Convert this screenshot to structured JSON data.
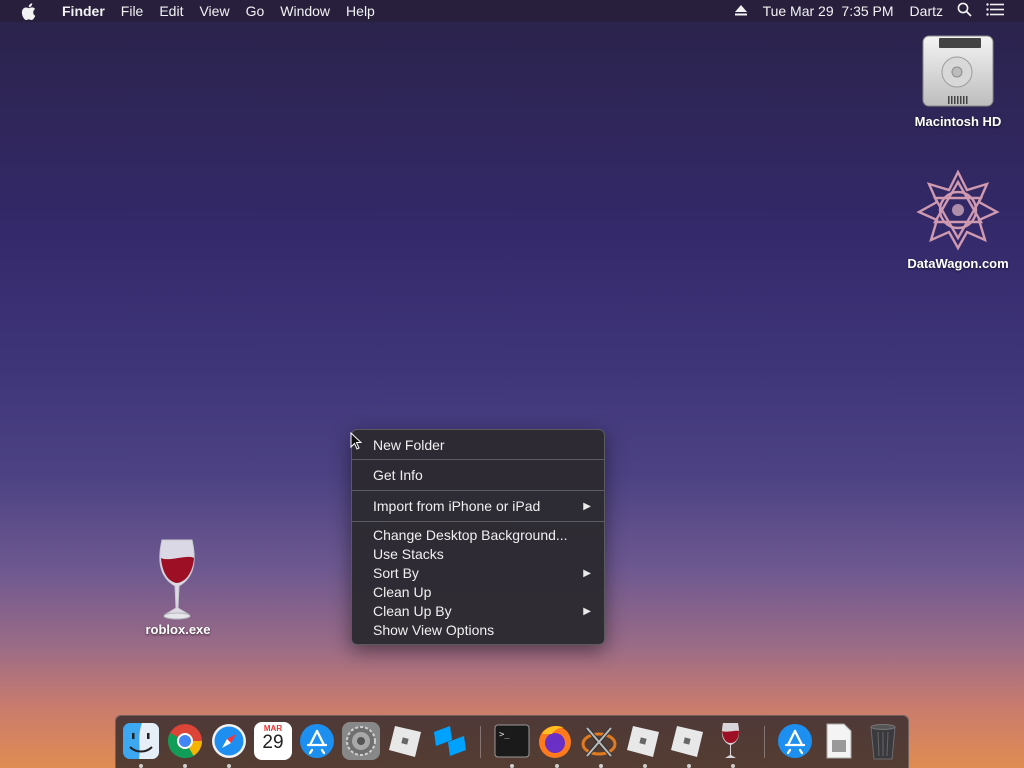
{
  "menubar": {
    "apple_icon": "apple-icon",
    "items": [
      "Finder",
      "File",
      "Edit",
      "View",
      "Go",
      "Window",
      "Help"
    ],
    "status": {
      "eject_icon": "eject-icon",
      "datetime": "Tue Mar 29  7:35 PM",
      "user": "Dartz",
      "search_icon": "search-icon",
      "list_icon": "list-icon"
    }
  },
  "desktop": {
    "icons": [
      {
        "label": "Macintosh HD",
        "icon": "hard-drive-icon"
      },
      {
        "label": "DataWagon.com",
        "icon": "network-share-icon"
      },
      {
        "label": "roblox.exe",
        "icon": "wine-glass-icon"
      }
    ]
  },
  "context_menu": {
    "items": [
      {
        "label": "New Folder",
        "submenu": false
      },
      {
        "label": "Get Info",
        "submenu": false
      },
      {
        "label": "Import from iPhone or iPad",
        "submenu": true
      },
      {
        "label": "Change Desktop Background...",
        "submenu": false
      },
      {
        "label": "Use Stacks",
        "submenu": false
      },
      {
        "label": "Sort By",
        "submenu": true
      },
      {
        "label": "Clean Up",
        "submenu": false
      },
      {
        "label": "Clean Up By",
        "submenu": true
      },
      {
        "label": "Show View Options",
        "submenu": false
      }
    ],
    "submenu_arrow": "▶"
  },
  "dock": {
    "calendar_month": "MAR",
    "calendar_day": "29",
    "apps": [
      {
        "name": "finder",
        "running": true
      },
      {
        "name": "chrome",
        "running": true
      },
      {
        "name": "safari",
        "running": true
      },
      {
        "name": "calendar",
        "running": false
      },
      {
        "name": "app-store",
        "running": false
      },
      {
        "name": "system-preferences",
        "running": false
      },
      {
        "name": "roblox",
        "running": false
      },
      {
        "name": "roblox-studio",
        "running": false
      },
      {
        "name": "terminal",
        "running": true
      },
      {
        "name": "firefox",
        "running": true
      },
      {
        "name": "xquartz",
        "running": true
      },
      {
        "name": "roblox-2",
        "running": true
      },
      {
        "name": "roblox-3",
        "running": true
      },
      {
        "name": "wine",
        "running": true
      },
      {
        "name": "app-store-downloads",
        "running": false
      },
      {
        "name": "documents",
        "running": false
      },
      {
        "name": "trash",
        "running": false
      }
    ]
  }
}
